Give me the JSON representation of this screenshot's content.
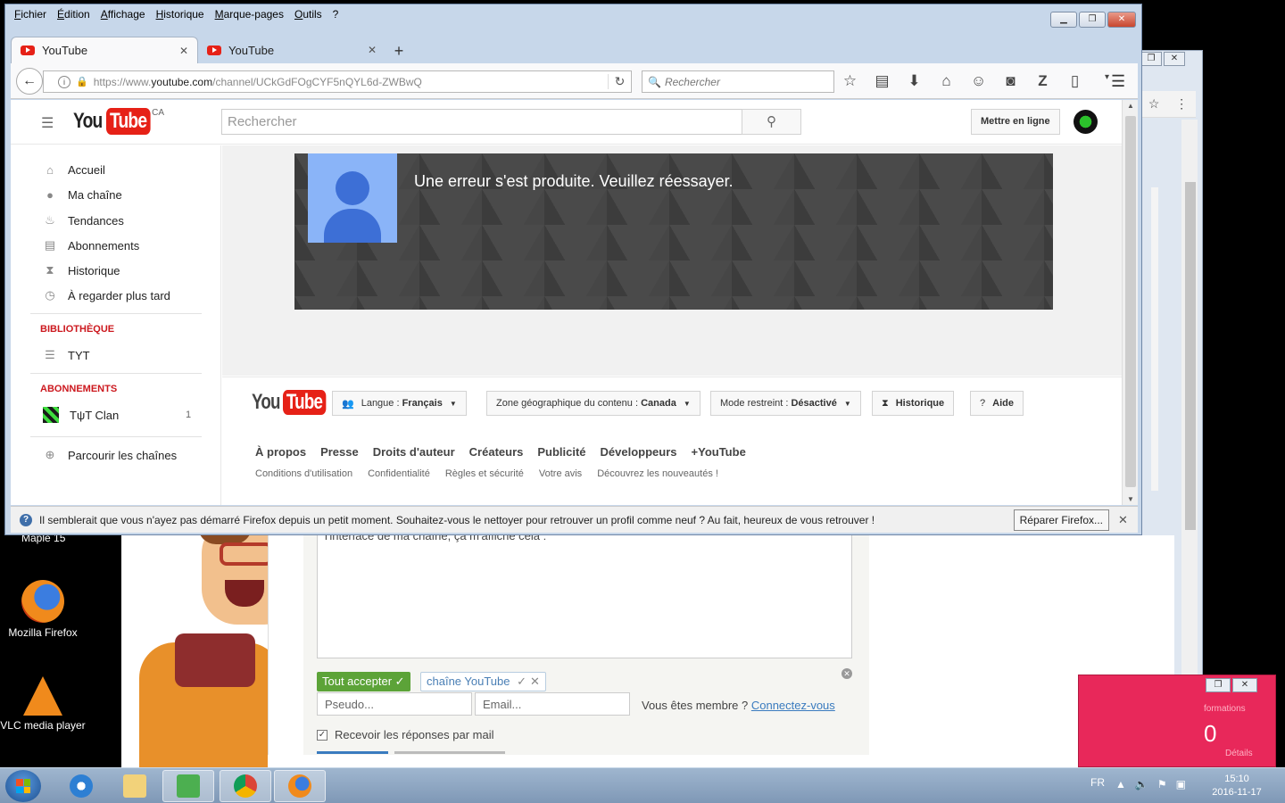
{
  "firefox": {
    "menu": [
      "Fichier",
      "Édition",
      "Affichage",
      "Historique",
      "Marque-pages",
      "Outils",
      "?"
    ],
    "tabs": [
      {
        "label": "YouTube",
        "active": true
      },
      {
        "label": "YouTube",
        "active": false
      }
    ],
    "url_prefix": "https://www.",
    "url_domain": "youtube.com",
    "url_path": "/channel/UCkGdFOgCYF5nQYL6d-ZWBwQ",
    "search_placeholder": "Rechercher",
    "notification": "Il semblerait que vous n'ayez pas démarré Firefox depuis un petit moment. Souhaitez-vous le nettoyer pour retrouver un profil comme neuf ? Au fait, heureux de vous retrouver !",
    "repair_button": "Réparer Firefox..."
  },
  "youtube": {
    "logo_you": "You",
    "logo_tube": "Tube",
    "region": "CA",
    "search_placeholder": "Rechercher",
    "upload_button": "Mettre en ligne",
    "guide": {
      "items": [
        {
          "label": "Accueil",
          "icon": "home-icon"
        },
        {
          "label": "Ma chaîne",
          "icon": "account-icon"
        },
        {
          "label": "Tendances",
          "icon": "flame-icon"
        },
        {
          "label": "Abonnements",
          "icon": "subscriptions-icon"
        },
        {
          "label": "Historique",
          "icon": "hourglass-icon"
        },
        {
          "label": "À regarder plus tard",
          "icon": "clock-icon"
        }
      ],
      "library_heading": "BIBLIOTHÈQUE",
      "library_item": "TYT",
      "subscriptions_heading": "ABONNEMENTS",
      "subscription_item": "TψT Clan",
      "subscription_count": "1",
      "browse_channels": "Parcourir les chaînes"
    },
    "banner_error": "Une erreur s'est produite. Veuillez réessayer.",
    "footer": {
      "language_label": "Langue : ",
      "language_value": "Français",
      "region_label": "Zone géographique du contenu : ",
      "region_value": "Canada",
      "restricted_label": "Mode restreint : ",
      "restricted_value": "Désactivé",
      "history": "Historique",
      "help": "Aide",
      "links_primary": [
        "À propos",
        "Presse",
        "Droits d'auteur",
        "Créateurs",
        "Publicité",
        "Développeurs",
        "+YouTube"
      ],
      "links_secondary": [
        "Conditions d'utilisation",
        "Confidentialité",
        "Règles et sécurité",
        "Votre avis",
        "Découvrez les nouveautés !"
      ]
    }
  },
  "background_page": {
    "textarea_text": "l'interface de ma chaîne, ça m'affiche cela :",
    "accept_all": "Tout accepter",
    "tag": "chaîne YouTube",
    "pseudo_placeholder": "Pseudo...",
    "email_placeholder": "Email...",
    "member_text": "Vous êtes membre ? ",
    "login_link": "Connectez-vous",
    "receive_mail": "Recevoir les réponses par mail",
    "av_info": "formations",
    "av_zero": "0",
    "av_details": "Détails"
  },
  "desktop": {
    "icons": [
      {
        "label": "Mozilla Firefox"
      },
      {
        "label": "VLC media player"
      }
    ],
    "maple_partial": "Maple 15"
  },
  "taskbar": {
    "lang": "FR",
    "time": "15:10",
    "date": "2016-11-17"
  }
}
